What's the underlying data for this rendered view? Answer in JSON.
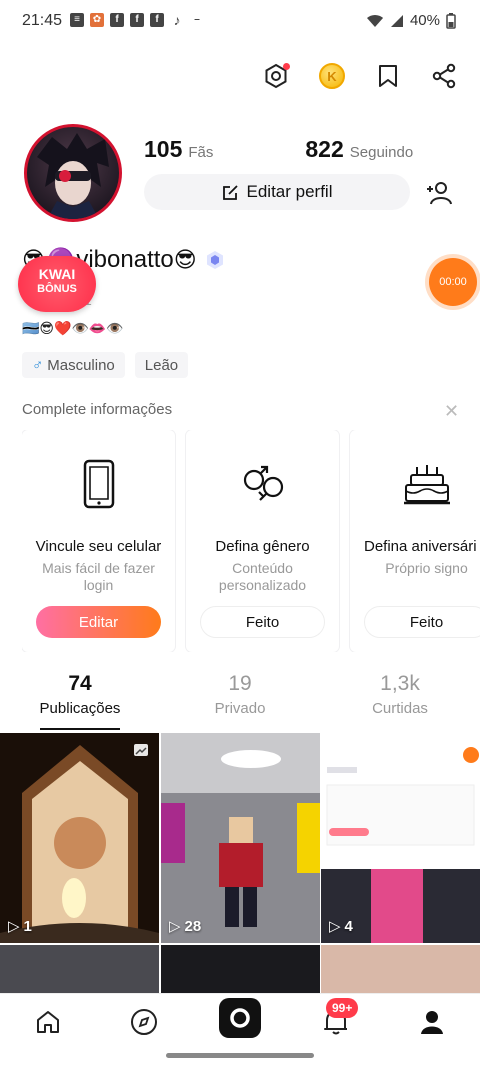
{
  "status_bar": {
    "time": "21:45",
    "battery": "40%"
  },
  "profile": {
    "fans_count": "105",
    "fans_label": "Fãs",
    "following_count": "822",
    "following_label": "Seguindo",
    "edit_button": "Editar perfil",
    "username": "vibonatto",
    "user_id": "1",
    "emoji_row": "🇧🇼😎❤️👁️👄👁️",
    "tags": [
      "Masculino",
      "Leão"
    ]
  },
  "kwai_bonus": {
    "line1": "KWAI",
    "line2": "BÔNUS"
  },
  "timer": "00:00",
  "complete_section": {
    "title": "Complete informações",
    "cards": [
      {
        "title": "Vincule seu celular",
        "subtitle": "Mais fácil de fazer login",
        "button": "Editar",
        "icon": "phone-icon"
      },
      {
        "title": "Defina gênero",
        "subtitle": "Conteúdo personalizado",
        "button": "Feito",
        "icon": "gender-icon"
      },
      {
        "title": "Defina aniversári",
        "subtitle": "Próprio signo",
        "button": "Feito",
        "icon": "cake-icon"
      }
    ]
  },
  "tabs": [
    {
      "count": "74",
      "label": "Publicações"
    },
    {
      "count": "19",
      "label": "Privado"
    },
    {
      "count": "1,3k",
      "label": "Curtidas"
    }
  ],
  "videos": [
    {
      "views": "1"
    },
    {
      "views": "28"
    },
    {
      "views": "4"
    }
  ],
  "notifications_badge": "99+"
}
